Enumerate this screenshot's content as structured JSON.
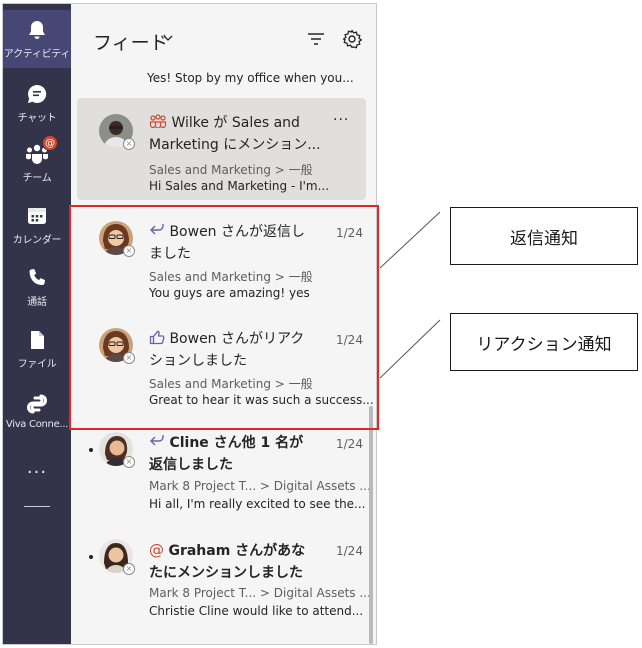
{
  "rail": {
    "items": [
      {
        "label": "アクティビティ",
        "icon": "bell-icon"
      },
      {
        "label": "チャット",
        "icon": "chat-icon"
      },
      {
        "label": "チーム",
        "icon": "teams-icon",
        "badge": "@"
      },
      {
        "label": "カレンダー",
        "icon": "calendar-icon"
      },
      {
        "label": "通話",
        "icon": "phone-icon"
      },
      {
        "label": "ファイル",
        "icon": "file-icon"
      },
      {
        "label": "Viva Conne...",
        "icon": "viva-icon"
      }
    ],
    "more": "···"
  },
  "feed": {
    "title": "フィード",
    "partial_preview": "Yes! Stop by my office when you...",
    "items": [
      {
        "title_line1": " Wilke が Sales and",
        "title_line2": "Marketing にメンション...",
        "sub": "Sales and Marketing > 一般",
        "preview": "Hi Sales and Marketing - I'm...",
        "more": "···",
        "icon": "team-mention-icon"
      },
      {
        "title_line1": " Bowen さんが返信し",
        "title_line2": "ました",
        "sub": "Sales and Marketing > 一般",
        "preview": "You guys are amazing! yes",
        "date": "1/24",
        "icon": "reply-icon"
      },
      {
        "title_line1": " Bowen さんがリアク",
        "title_line2": "ションしました",
        "sub": "Sales and Marketing > 一般",
        "preview": "Great to hear it was such a success...",
        "date": "1/24",
        "icon": "thumbs-up-icon"
      },
      {
        "title_name": "Cline",
        "title_rest": " さん他 1 名が",
        "title_line2": "返信しました",
        "sub": "Mark 8 Project T... > Digital Assets ...",
        "preview": "Hi all, I'm really excited to see the...",
        "date": "1/24",
        "icon": "reply-icon",
        "unread": true
      },
      {
        "title_name": "Graham",
        "title_rest": " さんがあな",
        "title_line2": "たにメンションしました",
        "sub": "Mark 8 Project T... > Digital Assets ...",
        "preview": "Christie Cline would like to attend...",
        "date": "1/24",
        "icon": "at-mention-icon",
        "unread": true
      }
    ]
  },
  "callouts": {
    "reply": "返信通知",
    "reaction": "リアクション通知"
  },
  "colors": {
    "rail_bg": "#33344a",
    "rail_active": "#464775",
    "accent": "#6264a7",
    "highlight": "#e02828",
    "badge": "#cc4a31"
  }
}
